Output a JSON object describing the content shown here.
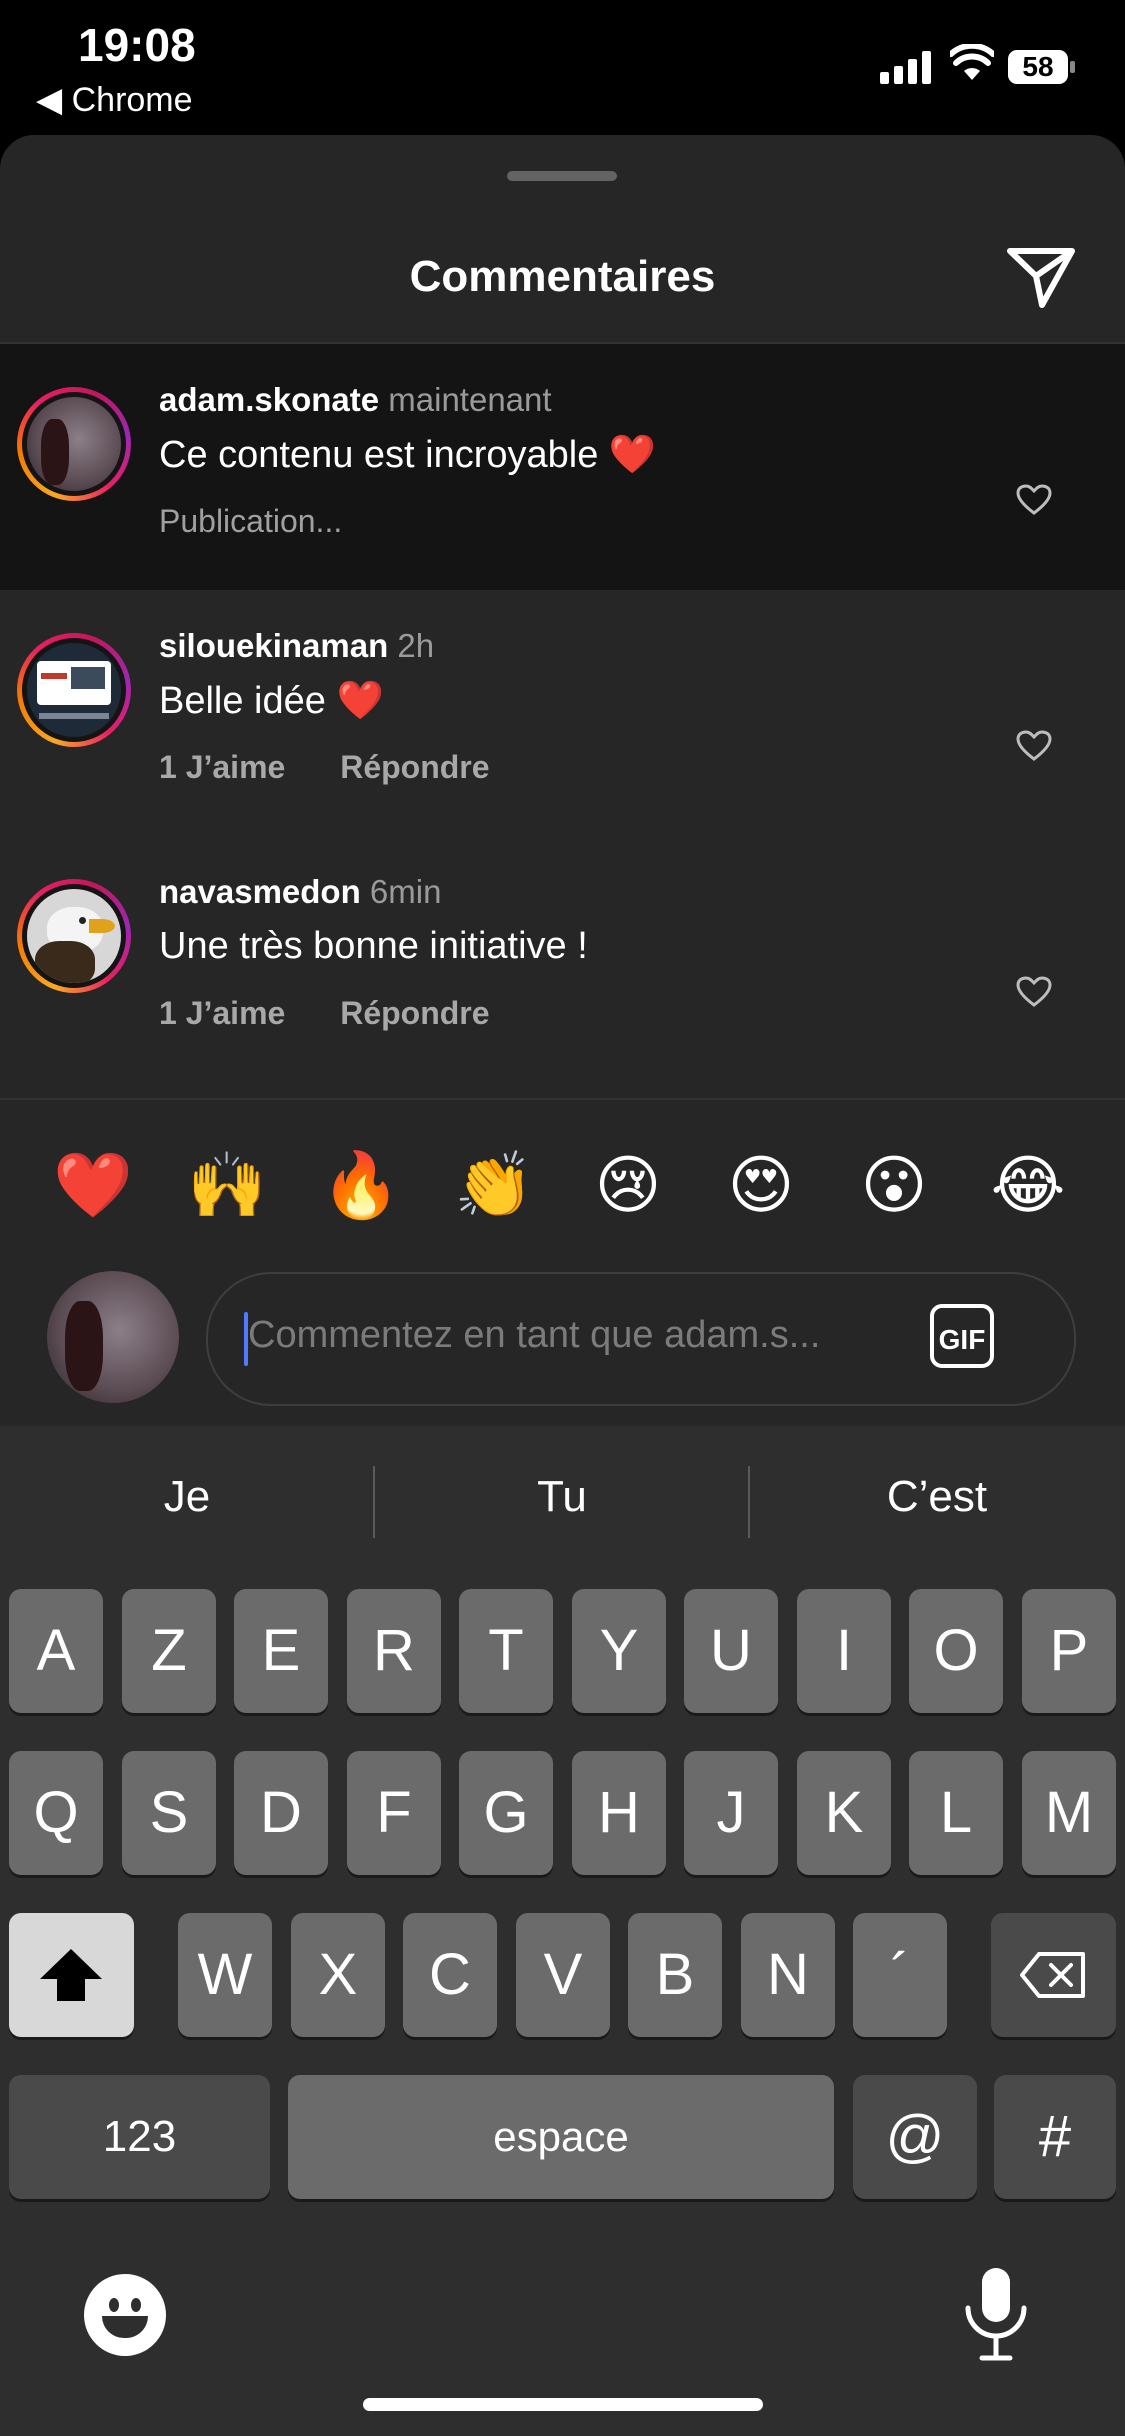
{
  "status_bar": {
    "time": "19:08",
    "back_label": "Chrome",
    "battery": "58"
  },
  "sheet": {
    "title": "Commentaires"
  },
  "comments": [
    {
      "username": "adam.skonate",
      "time": "maintenant",
      "text": "Ce contenu est incroyable ❤️",
      "status": "Publication..."
    },
    {
      "username": "silouekinaman",
      "time": "2h",
      "text": "Belle idée ❤️",
      "likes": "1 J’aime",
      "reply": "Répondre"
    },
    {
      "username": "navasmedon",
      "time": "6min",
      "text": "Une très bonne initiative !",
      "likes": "1 J’aime",
      "reply": "Répondre"
    }
  ],
  "quick_reactions": [
    "❤️",
    "🙌",
    "🔥",
    "👏",
    "😢",
    "😍",
    "😮",
    "😂"
  ],
  "composer": {
    "placeholder": "Commentez en tant que adam.s...",
    "gif_label": "GIF"
  },
  "keyboard": {
    "suggestions": [
      "Je",
      "Tu",
      "C’est"
    ],
    "row1": [
      "A",
      "Z",
      "E",
      "R",
      "T",
      "Y",
      "U",
      "I",
      "O",
      "P"
    ],
    "row2": [
      "Q",
      "S",
      "D",
      "F",
      "G",
      "H",
      "J",
      "K",
      "L",
      "M"
    ],
    "row3": [
      "W",
      "X",
      "C",
      "V",
      "B",
      "N",
      "´"
    ],
    "numbers_label": "123",
    "space_label": "espace",
    "at_label": "@",
    "hash_label": "#"
  }
}
